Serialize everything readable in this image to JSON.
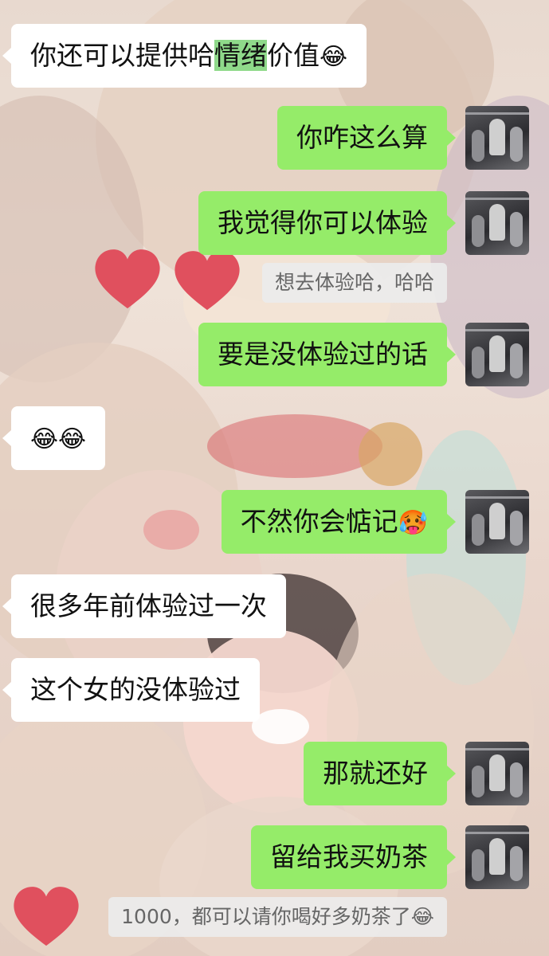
{
  "chat": {
    "messages": [
      {
        "dir": "in",
        "pre": "你还可以提供哈",
        "highlight": "情绪",
        "post": "价值",
        "emoji": "😂"
      },
      {
        "dir": "out",
        "text": "你咋这么算"
      },
      {
        "dir": "out",
        "text": "我觉得你可以体验",
        "quote": "想去体验哈，哈哈"
      },
      {
        "dir": "out",
        "text": "要是没体验过的话"
      },
      {
        "dir": "in",
        "emoji": "😂😂"
      },
      {
        "dir": "out",
        "text": "不然你会惦记",
        "emoji": "🥵"
      },
      {
        "dir": "in",
        "text": "很多年前体验过一次"
      },
      {
        "dir": "in",
        "text": "这个女的没体验过"
      },
      {
        "dir": "out",
        "text": "那就还好"
      },
      {
        "dir": "out",
        "text": "留给我买奶茶",
        "quote": "1000，都可以请你喝好多奶茶了😂"
      }
    ]
  },
  "colors": {
    "outgoing_bubble": "#95ec69",
    "incoming_bubble": "#ffffff",
    "highlight": "#8fd98a",
    "heart": "#e0505e"
  },
  "icons": {
    "sticker": "heart-icon",
    "avatar": "concert-photo-avatar"
  }
}
